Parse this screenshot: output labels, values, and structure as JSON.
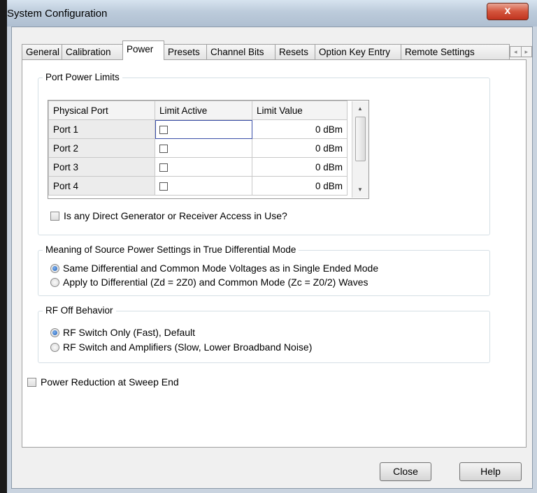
{
  "window": {
    "title": "System Configuration",
    "close_glyph": "x"
  },
  "tabs": [
    {
      "label": "General"
    },
    {
      "label": "Calibration"
    },
    {
      "label": "Power"
    },
    {
      "label": "Presets"
    },
    {
      "label": "Channel Bits"
    },
    {
      "label": "Resets"
    },
    {
      "label": "Option Key Entry"
    },
    {
      "label": "Remote Settings"
    }
  ],
  "active_tab": "Power",
  "tab_scroll": {
    "left": "◂",
    "right": "▸"
  },
  "port_power": {
    "title": "Port Power Limits",
    "columns": [
      "Physical Port",
      "Limit Active",
      "Limit Value"
    ],
    "rows": [
      {
        "port": "Port 1",
        "active": false,
        "value": "0 dBm"
      },
      {
        "port": "Port 2",
        "active": false,
        "value": "0 dBm"
      },
      {
        "port": "Port 3",
        "active": false,
        "value": "0 dBm"
      },
      {
        "port": "Port 4",
        "active": false,
        "value": "0 dBm"
      }
    ],
    "scroll_up": "▲",
    "scroll_down": "▼",
    "direct_access_label": "Is any Direct Generator or Receiver Access in Use?"
  },
  "differential": {
    "title": "Meaning of Source Power Settings in True Differential Mode",
    "options": [
      "Same Differential and Common Mode Voltages as in Single Ended Mode",
      "Apply to Differential (Zd = 2Z0) and Common Mode (Zc = Z0/2) Waves"
    ],
    "selected": 0
  },
  "rf_off": {
    "title": "RF Off Behavior",
    "options": [
      "RF Switch Only (Fast), Default",
      "RF Switch and Amplifiers (Slow, Lower Broadband Noise)"
    ],
    "selected": 0
  },
  "power_reduction_label": "Power Reduction at Sweep End",
  "buttons": {
    "close": "Close",
    "help": "Help"
  }
}
